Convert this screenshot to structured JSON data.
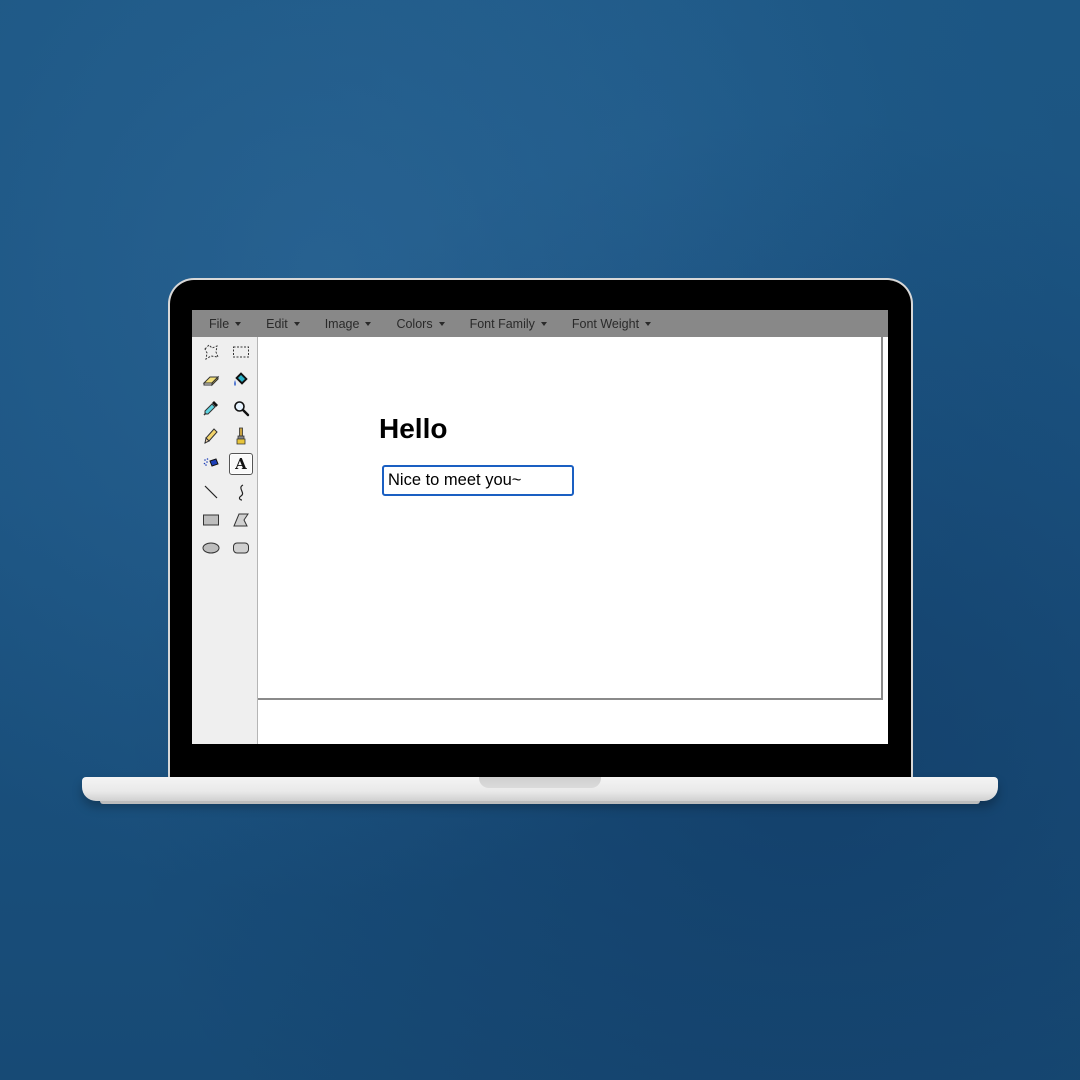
{
  "menubar": {
    "items": [
      {
        "label": "File"
      },
      {
        "label": "Edit"
      },
      {
        "label": "Image"
      },
      {
        "label": "Colors"
      },
      {
        "label": "Font Family"
      },
      {
        "label": "Font Weight"
      }
    ]
  },
  "toolbox": {
    "tools": [
      {
        "name": "free-form-select-icon"
      },
      {
        "name": "rectangle-select-icon"
      },
      {
        "name": "eraser-icon"
      },
      {
        "name": "fill-bucket-icon"
      },
      {
        "name": "color-picker-icon"
      },
      {
        "name": "magnifier-icon"
      },
      {
        "name": "pencil-icon"
      },
      {
        "name": "brush-icon"
      },
      {
        "name": "airbrush-icon"
      },
      {
        "name": "text-tool-icon",
        "selected": true,
        "glyph": "A"
      },
      {
        "name": "line-icon"
      },
      {
        "name": "curve-icon"
      },
      {
        "name": "rectangle-icon"
      },
      {
        "name": "polygon-icon"
      },
      {
        "name": "ellipse-icon"
      },
      {
        "name": "rounded-rectangle-icon"
      }
    ]
  },
  "canvas": {
    "heading": "Hello",
    "text_input": {
      "value": "Nice to meet you~"
    }
  },
  "colors": {
    "background": "#1b5381",
    "menubar": "#888888",
    "input_border": "#1a5fc2"
  }
}
